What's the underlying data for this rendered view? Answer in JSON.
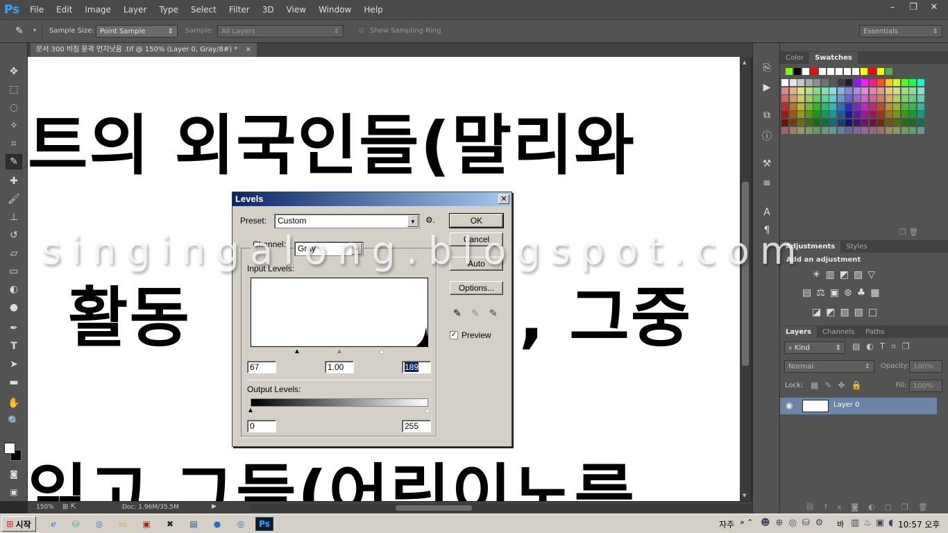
{
  "app": {
    "logo": "Ps",
    "menu": [
      "File",
      "Edit",
      "Image",
      "Layer",
      "Type",
      "Select",
      "Filter",
      "3D",
      "View",
      "Window",
      "Help"
    ],
    "win_buttons": [
      "–",
      "❐",
      "✕"
    ]
  },
  "options_bar": {
    "sample_size_label": "Sample Size:",
    "sample_size_value": "Point Sample",
    "sample_label": "Sample:",
    "sample_value": "All Layers",
    "show_ring_label": "Show Sampling Ring",
    "workspace": "Essentials"
  },
  "document": {
    "tab_title": "문서 300 비침 윤곽 먼지낫음 .tif @ 150% (Layer 0, Gray/8#) *",
    "tab_close": "×",
    "canvas_lines": [
      "트의 외국인들(말리와",
      "활동",
      ", 그중",
      "읽고  그들(어린이노릇"
    ],
    "watermark": "singingalong.blogspot.com"
  },
  "status_bar": {
    "zoom": "150%",
    "doc_info": "Doc: 1.96M/35.5M"
  },
  "panels": {
    "color_tabs": [
      "Color",
      "Swatches"
    ],
    "adjust_tabs": [
      "Adjustments",
      "Styles"
    ],
    "adjust_hint": "Add an adjustment",
    "layers_tabs": [
      "Layers",
      "Channels",
      "Paths"
    ],
    "kind_filter": "Kind",
    "blend_mode": "Normal",
    "opacity_label": "Opacity:",
    "opacity_value": "100%",
    "lock_label": "Lock:",
    "fill_label": "Fill:",
    "fill_value": "100%",
    "layer_name": "Layer 0"
  },
  "levels": {
    "title": "Levels",
    "preset_label": "Preset:",
    "preset_value": "Custom",
    "channel_label": "Channel:",
    "channel_value": "Gray",
    "input_label": "Input Levels:",
    "input_black": "67",
    "input_gamma": "1.00",
    "input_white": "189",
    "output_label": "Output Levels:",
    "output_black": "0",
    "output_white": "255",
    "ok": "OK",
    "cancel": "Cancel",
    "auto": "Auto",
    "options": "Options...",
    "preview_label": "Preview",
    "preview_checked": true
  },
  "taskbar": {
    "start_label": "시작",
    "tray_text": "자주",
    "clock": "10:57 오후",
    "ime": "바"
  }
}
